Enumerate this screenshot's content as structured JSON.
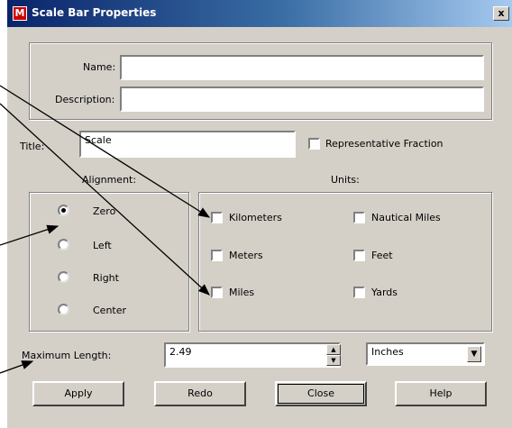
{
  "window": {
    "title": "Scale Bar Properties",
    "close_label": "x",
    "icon": "app-icon"
  },
  "name_field": {
    "label": "Name:",
    "value": ""
  },
  "description_field": {
    "label": "Description:",
    "value": ""
  },
  "title_field": {
    "label": "Title:",
    "value": "Scale"
  },
  "representative_fraction": {
    "label": "Representative Fraction",
    "checked": false
  },
  "alignment": {
    "heading": "Alignment:",
    "options": [
      {
        "label": "Zero",
        "selected": true
      },
      {
        "label": "Left",
        "selected": false
      },
      {
        "label": "Right",
        "selected": false
      },
      {
        "label": "Center",
        "selected": false
      }
    ]
  },
  "units": {
    "heading": "Units:",
    "options": [
      {
        "label": "Kilometers",
        "checked": false
      },
      {
        "label": "Nautical Miles",
        "checked": false
      },
      {
        "label": "Meters",
        "checked": false
      },
      {
        "label": "Feet",
        "checked": false
      },
      {
        "label": "Miles",
        "checked": false
      },
      {
        "label": "Yards",
        "checked": false
      }
    ]
  },
  "maximum_length": {
    "label": "Maximum Length:",
    "value": "2.49",
    "unit": "Inches"
  },
  "buttons": {
    "apply": "Apply",
    "redo": "Redo",
    "close": "Close",
    "help": "Help"
  }
}
